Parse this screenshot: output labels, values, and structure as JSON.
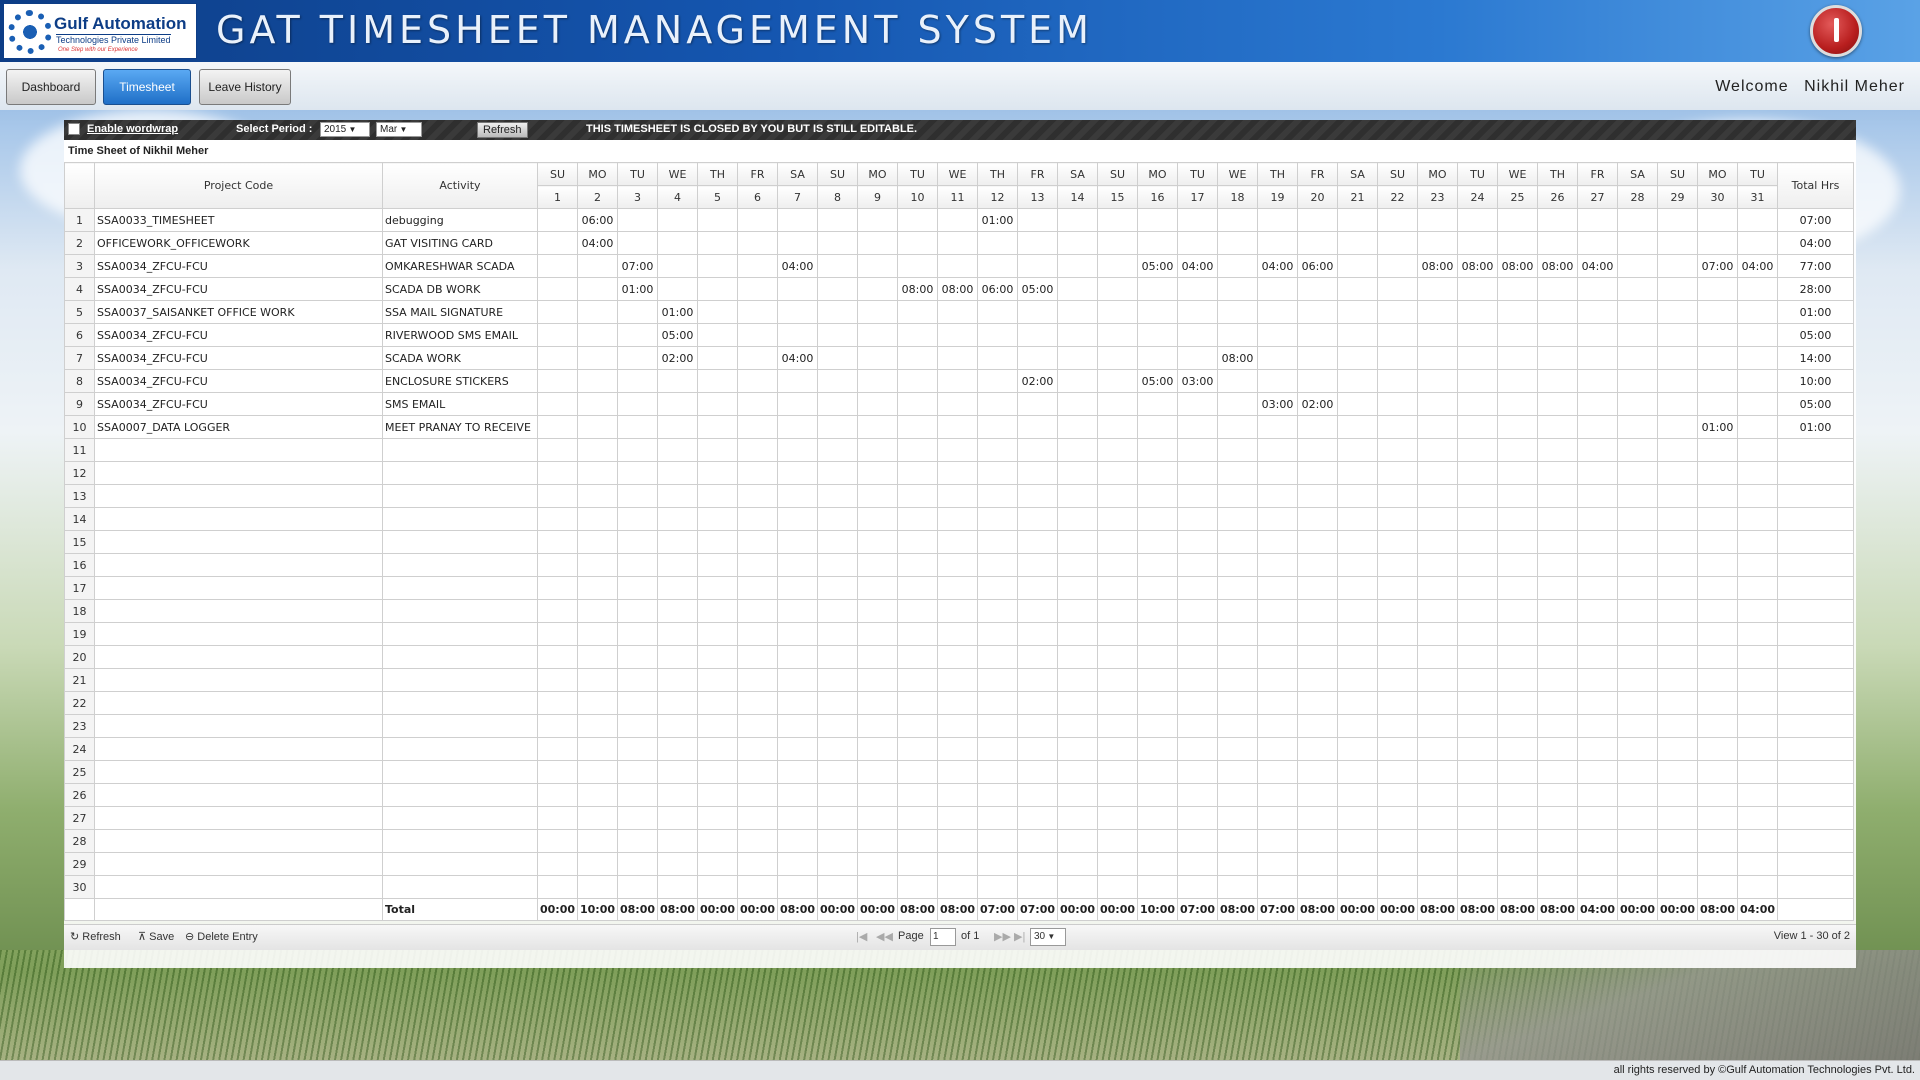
{
  "header": {
    "logo_line1": "Gulf Automation",
    "logo_line2": "Technologies Private Limited",
    "logo_tagline": "One Step with our Experience",
    "title": "GAT TIMESHEET MANAGEMENT SYSTEM",
    "power_icon": "power-icon"
  },
  "nav": {
    "dashboard": "Dashboard",
    "timesheet": "Timesheet",
    "leave_history": "Leave History",
    "welcome_label": "Welcome",
    "user_name": "Nikhil Meher"
  },
  "toolbar": {
    "wordwrap_label": "Enable wordwrap",
    "period_label": "Select Period :",
    "year": "2015",
    "month": "Mar",
    "refresh_label": "Refresh",
    "status_message": "THIS TIMESHEET IS CLOSED BY YOU BUT IS STILL EDITABLE."
  },
  "grid": {
    "caption": "Time Sheet of Nikhil Meher",
    "col_project": "Project Code",
    "col_activity": "Activity",
    "col_total": "Total Hrs",
    "days": [
      "SU",
      "MO",
      "TU",
      "WE",
      "TH",
      "FR",
      "SA",
      "SU",
      "MO",
      "TU",
      "WE",
      "TH",
      "FR",
      "SA",
      "SU",
      "MO",
      "TU",
      "WE",
      "TH",
      "FR",
      "SA",
      "SU",
      "MO",
      "TU",
      "WE",
      "TH",
      "FR",
      "SA",
      "SU",
      "MO",
      "TU"
    ],
    "dates": [
      "1",
      "2",
      "3",
      "4",
      "5",
      "6",
      "7",
      "8",
      "9",
      "10",
      "11",
      "12",
      "13",
      "14",
      "15",
      "16",
      "17",
      "18",
      "19",
      "20",
      "21",
      "22",
      "23",
      "24",
      "25",
      "26",
      "27",
      "28",
      "29",
      "30",
      "31"
    ],
    "rows": [
      {
        "code": "SSA0033_TIMESHEET",
        "activity": "debugging",
        "hours": [
          "",
          "06:00",
          "",
          "",
          "",
          "",
          "",
          "",
          "",
          "",
          "",
          "01:00",
          "",
          "",
          "",
          "",
          "",
          "",
          "",
          "",
          "",
          "",
          "",
          "",
          "",
          "",
          "",
          "",
          "",
          "",
          ""
        ],
        "total": "07:00"
      },
      {
        "code": "OFFICEWORK_OFFICEWORK",
        "activity": "GAT VISITING CARD",
        "hours": [
          "",
          "04:00",
          "",
          "",
          "",
          "",
          "",
          "",
          "",
          "",
          "",
          "",
          "",
          "",
          "",
          "",
          "",
          "",
          "",
          "",
          "",
          "",
          "",
          "",
          "",
          "",
          "",
          "",
          "",
          "",
          ""
        ],
        "total": "04:00"
      },
      {
        "code": "SSA0034_ZFCU-FCU",
        "activity": "OMKARESHWAR SCADA",
        "hours": [
          "",
          "",
          "07:00",
          "",
          "",
          "",
          "04:00",
          "",
          "",
          "",
          "",
          "",
          "",
          "",
          "",
          "05:00",
          "04:00",
          "",
          "04:00",
          "06:00",
          "",
          "",
          "08:00",
          "08:00",
          "08:00",
          "08:00",
          "04:00",
          "",
          "",
          "07:00",
          "04:00"
        ],
        "total": "77:00"
      },
      {
        "code": "SSA0034_ZFCU-FCU",
        "activity": "SCADA DB WORK",
        "hours": [
          "",
          "",
          "01:00",
          "",
          "",
          "",
          "",
          "",
          "",
          "08:00",
          "08:00",
          "06:00",
          "05:00",
          "",
          "",
          "",
          "",
          "",
          "",
          "",
          "",
          "",
          "",
          "",
          "",
          "",
          "",
          "",
          "",
          "",
          ""
        ],
        "total": "28:00"
      },
      {
        "code": "SSA0037_SAISANKET OFFICE WORK",
        "activity": "SSA MAIL SIGNATURE",
        "hours": [
          "",
          "",
          "",
          "01:00",
          "",
          "",
          "",
          "",
          "",
          "",
          "",
          "",
          "",
          "",
          "",
          "",
          "",
          "",
          "",
          "",
          "",
          "",
          "",
          "",
          "",
          "",
          "",
          "",
          "",
          "",
          ""
        ],
        "total": "01:00"
      },
      {
        "code": "SSA0034_ZFCU-FCU",
        "activity": "RIVERWOOD SMS EMAIL",
        "hours": [
          "",
          "",
          "",
          "05:00",
          "",
          "",
          "",
          "",
          "",
          "",
          "",
          "",
          "",
          "",
          "",
          "",
          "",
          "",
          "",
          "",
          "",
          "",
          "",
          "",
          "",
          "",
          "",
          "",
          "",
          "",
          ""
        ],
        "total": "05:00"
      },
      {
        "code": "SSA0034_ZFCU-FCU",
        "activity": "SCADA WORK",
        "hours": [
          "",
          "",
          "",
          "02:00",
          "",
          "",
          "04:00",
          "",
          "",
          "",
          "",
          "",
          "",
          "",
          "",
          "",
          "",
          "08:00",
          "",
          "",
          "",
          "",
          "",
          "",
          "",
          "",
          "",
          "",
          "",
          "",
          ""
        ],
        "total": "14:00"
      },
      {
        "code": "SSA0034_ZFCU-FCU",
        "activity": "ENCLOSURE STICKERS",
        "hours": [
          "",
          "",
          "",
          "",
          "",
          "",
          "",
          "",
          "",
          "",
          "",
          "",
          "02:00",
          "",
          "",
          "05:00",
          "03:00",
          "",
          "",
          "",
          "",
          "",
          "",
          "",
          "",
          "",
          "",
          "",
          "",
          "",
          ""
        ],
        "total": "10:00"
      },
      {
        "code": "SSA0034_ZFCU-FCU",
        "activity": "SMS EMAIL",
        "hours": [
          "",
          "",
          "",
          "",
          "",
          "",
          "",
          "",
          "",
          "",
          "",
          "",
          "",
          "",
          "",
          "",
          "",
          "",
          "03:00",
          "02:00",
          "",
          "",
          "",
          "",
          "",
          "",
          "",
          "",
          "",
          "",
          ""
        ],
        "total": "05:00"
      },
      {
        "code": "SSA0007_DATA LOGGER",
        "activity": "MEET PRANAY TO RECEIVE",
        "hours": [
          "",
          "",
          "",
          "",
          "",
          "",
          "",
          "",
          "",
          "",
          "",
          "",
          "",
          "",
          "",
          "",
          "",
          "",
          "",
          "",
          "",
          "",
          "",
          "",
          "",
          "",
          "",
          "",
          "",
          "01:00",
          ""
        ],
        "total": "01:00"
      }
    ],
    "row_count": 30,
    "total_label": "Total",
    "day_totals": [
      "00:00",
      "10:00",
      "08:00",
      "08:00",
      "00:00",
      "00:00",
      "08:00",
      "00:00",
      "00:00",
      "08:00",
      "08:00",
      "07:00",
      "07:00",
      "00:00",
      "00:00",
      "10:00",
      "07:00",
      "08:00",
      "07:00",
      "08:00",
      "00:00",
      "00:00",
      "08:00",
      "08:00",
      "08:00",
      "08:00",
      "04:00",
      "00:00",
      "00:00",
      "08:00",
      "04:00"
    ]
  },
  "pager": {
    "refresh": "Refresh",
    "save": "Save",
    "delete": "Delete Entry",
    "page_label": "Page",
    "page_value": "1",
    "of_label": "of 1",
    "rows_per_page": "30",
    "view_text": "View 1 - 30 of 2"
  },
  "footer": {
    "text": "all rights reserved by ©Gulf Automation Technologies Pvt. Ltd."
  }
}
